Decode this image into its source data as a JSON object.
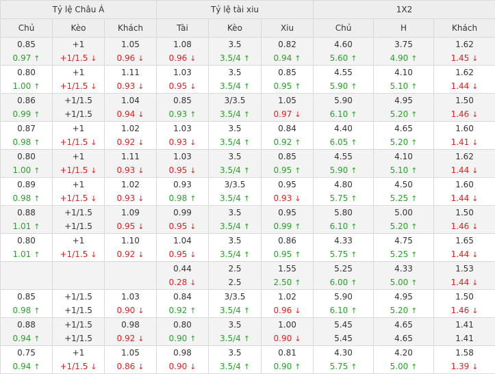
{
  "header": {
    "groups": [
      "Tỷ lệ Châu Á",
      "Tỷ lệ tài xiu",
      "1X2"
    ],
    "columns": [
      "Chủ",
      "Kèo",
      "Khách",
      "Tài",
      "Kèo",
      "Xiu",
      "Chủ",
      "H",
      "Khách"
    ]
  },
  "colors": {
    "up": "#2aa02a",
    "down": "#e01f1f"
  },
  "rows": [
    [
      {
        "top": "0.85",
        "bottom": "0.97",
        "trend": "up"
      },
      {
        "top": "+1",
        "bottom": "+1/1.5",
        "trend": "down"
      },
      {
        "top": "1.05",
        "bottom": "0.96",
        "trend": "down"
      },
      {
        "top": "1.08",
        "bottom": "0.96",
        "trend": "down"
      },
      {
        "top": "3.5",
        "bottom": "3.5/4",
        "trend": "up"
      },
      {
        "top": "0.82",
        "bottom": "0.94",
        "trend": "up"
      },
      {
        "top": "4.60",
        "bottom": "5.60",
        "trend": "up"
      },
      {
        "top": "3.75",
        "bottom": "4.90",
        "trend": "up"
      },
      {
        "top": "1.62",
        "bottom": "1.45",
        "trend": "down"
      }
    ],
    [
      {
        "top": "0.80",
        "bottom": "1.00",
        "trend": "up"
      },
      {
        "top": "+1",
        "bottom": "+1/1.5",
        "trend": "down"
      },
      {
        "top": "1.11",
        "bottom": "0.93",
        "trend": "down"
      },
      {
        "top": "1.03",
        "bottom": "0.95",
        "trend": "down"
      },
      {
        "top": "3.5",
        "bottom": "3.5/4",
        "trend": "up"
      },
      {
        "top": "0.85",
        "bottom": "0.95",
        "trend": "up"
      },
      {
        "top": "4.55",
        "bottom": "5.90",
        "trend": "up"
      },
      {
        "top": "4.10",
        "bottom": "5.10",
        "trend": "up"
      },
      {
        "top": "1.62",
        "bottom": "1.44",
        "trend": "down"
      }
    ],
    [
      {
        "top": "0.86",
        "bottom": "0.99",
        "trend": "up"
      },
      {
        "top": "+1/1.5",
        "bottom": "+1/1.5",
        "trend": "none"
      },
      {
        "top": "1.04",
        "bottom": "0.94",
        "trend": "down"
      },
      {
        "top": "0.85",
        "bottom": "0.93",
        "trend": "up"
      },
      {
        "top": "3/3.5",
        "bottom": "3.5/4",
        "trend": "up"
      },
      {
        "top": "1.05",
        "bottom": "0.97",
        "trend": "down"
      },
      {
        "top": "5.90",
        "bottom": "6.10",
        "trend": "up"
      },
      {
        "top": "4.95",
        "bottom": "5.20",
        "trend": "up"
      },
      {
        "top": "1.50",
        "bottom": "1.46",
        "trend": "down"
      }
    ],
    [
      {
        "top": "0.87",
        "bottom": "0.98",
        "trend": "up"
      },
      {
        "top": "+1",
        "bottom": "+1/1.5",
        "trend": "down"
      },
      {
        "top": "1.02",
        "bottom": "0.92",
        "trend": "down"
      },
      {
        "top": "1.03",
        "bottom": "0.93",
        "trend": "down"
      },
      {
        "top": "3.5",
        "bottom": "3.5/4",
        "trend": "up"
      },
      {
        "top": "0.84",
        "bottom": "0.92",
        "trend": "up"
      },
      {
        "top": "4.40",
        "bottom": "6.05",
        "trend": "up"
      },
      {
        "top": "4.65",
        "bottom": "5.20",
        "trend": "up"
      },
      {
        "top": "1.60",
        "bottom": "1.41",
        "trend": "down"
      }
    ],
    [
      {
        "top": "0.80",
        "bottom": "1.00",
        "trend": "up"
      },
      {
        "top": "+1",
        "bottom": "+1/1.5",
        "trend": "down"
      },
      {
        "top": "1.11",
        "bottom": "0.93",
        "trend": "down"
      },
      {
        "top": "1.03",
        "bottom": "0.95",
        "trend": "down"
      },
      {
        "top": "3.5",
        "bottom": "3.5/4",
        "trend": "up"
      },
      {
        "top": "0.85",
        "bottom": "0.95",
        "trend": "up"
      },
      {
        "top": "4.55",
        "bottom": "5.90",
        "trend": "up"
      },
      {
        "top": "4.10",
        "bottom": "5.10",
        "trend": "up"
      },
      {
        "top": "1.62",
        "bottom": "1.44",
        "trend": "down"
      }
    ],
    [
      {
        "top": "0.89",
        "bottom": "0.98",
        "trend": "up"
      },
      {
        "top": "+1",
        "bottom": "+1/1.5",
        "trend": "down"
      },
      {
        "top": "1.02",
        "bottom": "0.93",
        "trend": "down"
      },
      {
        "top": "0.93",
        "bottom": "0.98",
        "trend": "up"
      },
      {
        "top": "3/3.5",
        "bottom": "3.5/4",
        "trend": "up"
      },
      {
        "top": "0.95",
        "bottom": "0.93",
        "trend": "down"
      },
      {
        "top": "4.80",
        "bottom": "5.75",
        "trend": "up"
      },
      {
        "top": "4.50",
        "bottom": "5.25",
        "trend": "up"
      },
      {
        "top": "1.60",
        "bottom": "1.44",
        "trend": "down"
      }
    ],
    [
      {
        "top": "0.88",
        "bottom": "1.01",
        "trend": "up"
      },
      {
        "top": "+1/1.5",
        "bottom": "+1/1.5",
        "trend": "none"
      },
      {
        "top": "1.09",
        "bottom": "0.95",
        "trend": "down"
      },
      {
        "top": "0.99",
        "bottom": "0.95",
        "trend": "down"
      },
      {
        "top": "3.5",
        "bottom": "3.5/4",
        "trend": "up"
      },
      {
        "top": "0.95",
        "bottom": "0.99",
        "trend": "up"
      },
      {
        "top": "5.80",
        "bottom": "6.10",
        "trend": "up"
      },
      {
        "top": "5.00",
        "bottom": "5.20",
        "trend": "up"
      },
      {
        "top": "1.50",
        "bottom": "1.46",
        "trend": "down"
      }
    ],
    [
      {
        "top": "0.80",
        "bottom": "1.01",
        "trend": "up"
      },
      {
        "top": "+1",
        "bottom": "+1/1.5",
        "trend": "down"
      },
      {
        "top": "1.10",
        "bottom": "0.92",
        "trend": "down"
      },
      {
        "top": "1.04",
        "bottom": "0.95",
        "trend": "down"
      },
      {
        "top": "3.5",
        "bottom": "3.5/4",
        "trend": "up"
      },
      {
        "top": "0.86",
        "bottom": "0.95",
        "trend": "up"
      },
      {
        "top": "4.33",
        "bottom": "5.75",
        "trend": "up"
      },
      {
        "top": "4.75",
        "bottom": "5.25",
        "trend": "up"
      },
      {
        "top": "1.65",
        "bottom": "1.44",
        "trend": "down"
      }
    ],
    [
      {
        "top": "",
        "bottom": "",
        "trend": "none"
      },
      {
        "top": "",
        "bottom": "",
        "trend": "none"
      },
      {
        "top": "",
        "bottom": "",
        "trend": "none"
      },
      {
        "top": "0.44",
        "bottom": "0.28",
        "trend": "down"
      },
      {
        "top": "2.5",
        "bottom": "2.5",
        "trend": "none"
      },
      {
        "top": "1.55",
        "bottom": "2.50",
        "trend": "up"
      },
      {
        "top": "5.25",
        "bottom": "6.00",
        "trend": "up"
      },
      {
        "top": "4.33",
        "bottom": "5.00",
        "trend": "up"
      },
      {
        "top": "1.53",
        "bottom": "1.44",
        "trend": "down"
      }
    ],
    [
      {
        "top": "0.85",
        "bottom": "0.98",
        "trend": "up"
      },
      {
        "top": "+1/1.5",
        "bottom": "+1/1.5",
        "trend": "none"
      },
      {
        "top": "1.03",
        "bottom": "0.90",
        "trend": "down"
      },
      {
        "top": "0.84",
        "bottom": "0.92",
        "trend": "up"
      },
      {
        "top": "3/3.5",
        "bottom": "3.5/4",
        "trend": "up"
      },
      {
        "top": "1.02",
        "bottom": "0.96",
        "trend": "down"
      },
      {
        "top": "5.90",
        "bottom": "6.10",
        "trend": "up"
      },
      {
        "top": "4.95",
        "bottom": "5.20",
        "trend": "up"
      },
      {
        "top": "1.50",
        "bottom": "1.46",
        "trend": "down"
      }
    ],
    [
      {
        "top": "0.88",
        "bottom": "0.94",
        "trend": "up"
      },
      {
        "top": "+1/1.5",
        "bottom": "+1/1.5",
        "trend": "none"
      },
      {
        "top": "0.98",
        "bottom": "0.92",
        "trend": "down"
      },
      {
        "top": "0.80",
        "bottom": "0.90",
        "trend": "up"
      },
      {
        "top": "3.5",
        "bottom": "3.5/4",
        "trend": "up"
      },
      {
        "top": "1.00",
        "bottom": "0.90",
        "trend": "down"
      },
      {
        "top": "5.45",
        "bottom": "5.45",
        "trend": "none"
      },
      {
        "top": "4.65",
        "bottom": "4.65",
        "trend": "none"
      },
      {
        "top": "1.41",
        "bottom": "1.41",
        "trend": "none"
      }
    ],
    [
      {
        "top": "0.75",
        "bottom": "0.94",
        "trend": "up"
      },
      {
        "top": "+1",
        "bottom": "+1/1.5",
        "trend": "down"
      },
      {
        "top": "1.05",
        "bottom": "0.86",
        "trend": "down"
      },
      {
        "top": "0.98",
        "bottom": "0.90",
        "trend": "down"
      },
      {
        "top": "3.5",
        "bottom": "3.5/4",
        "trend": "up"
      },
      {
        "top": "0.81",
        "bottom": "0.90",
        "trend": "up"
      },
      {
        "top": "4.30",
        "bottom": "5.75",
        "trend": "up"
      },
      {
        "top": "4.20",
        "bottom": "5.00",
        "trend": "up"
      },
      {
        "top": "1.58",
        "bottom": "1.39",
        "trend": "down"
      }
    ]
  ]
}
